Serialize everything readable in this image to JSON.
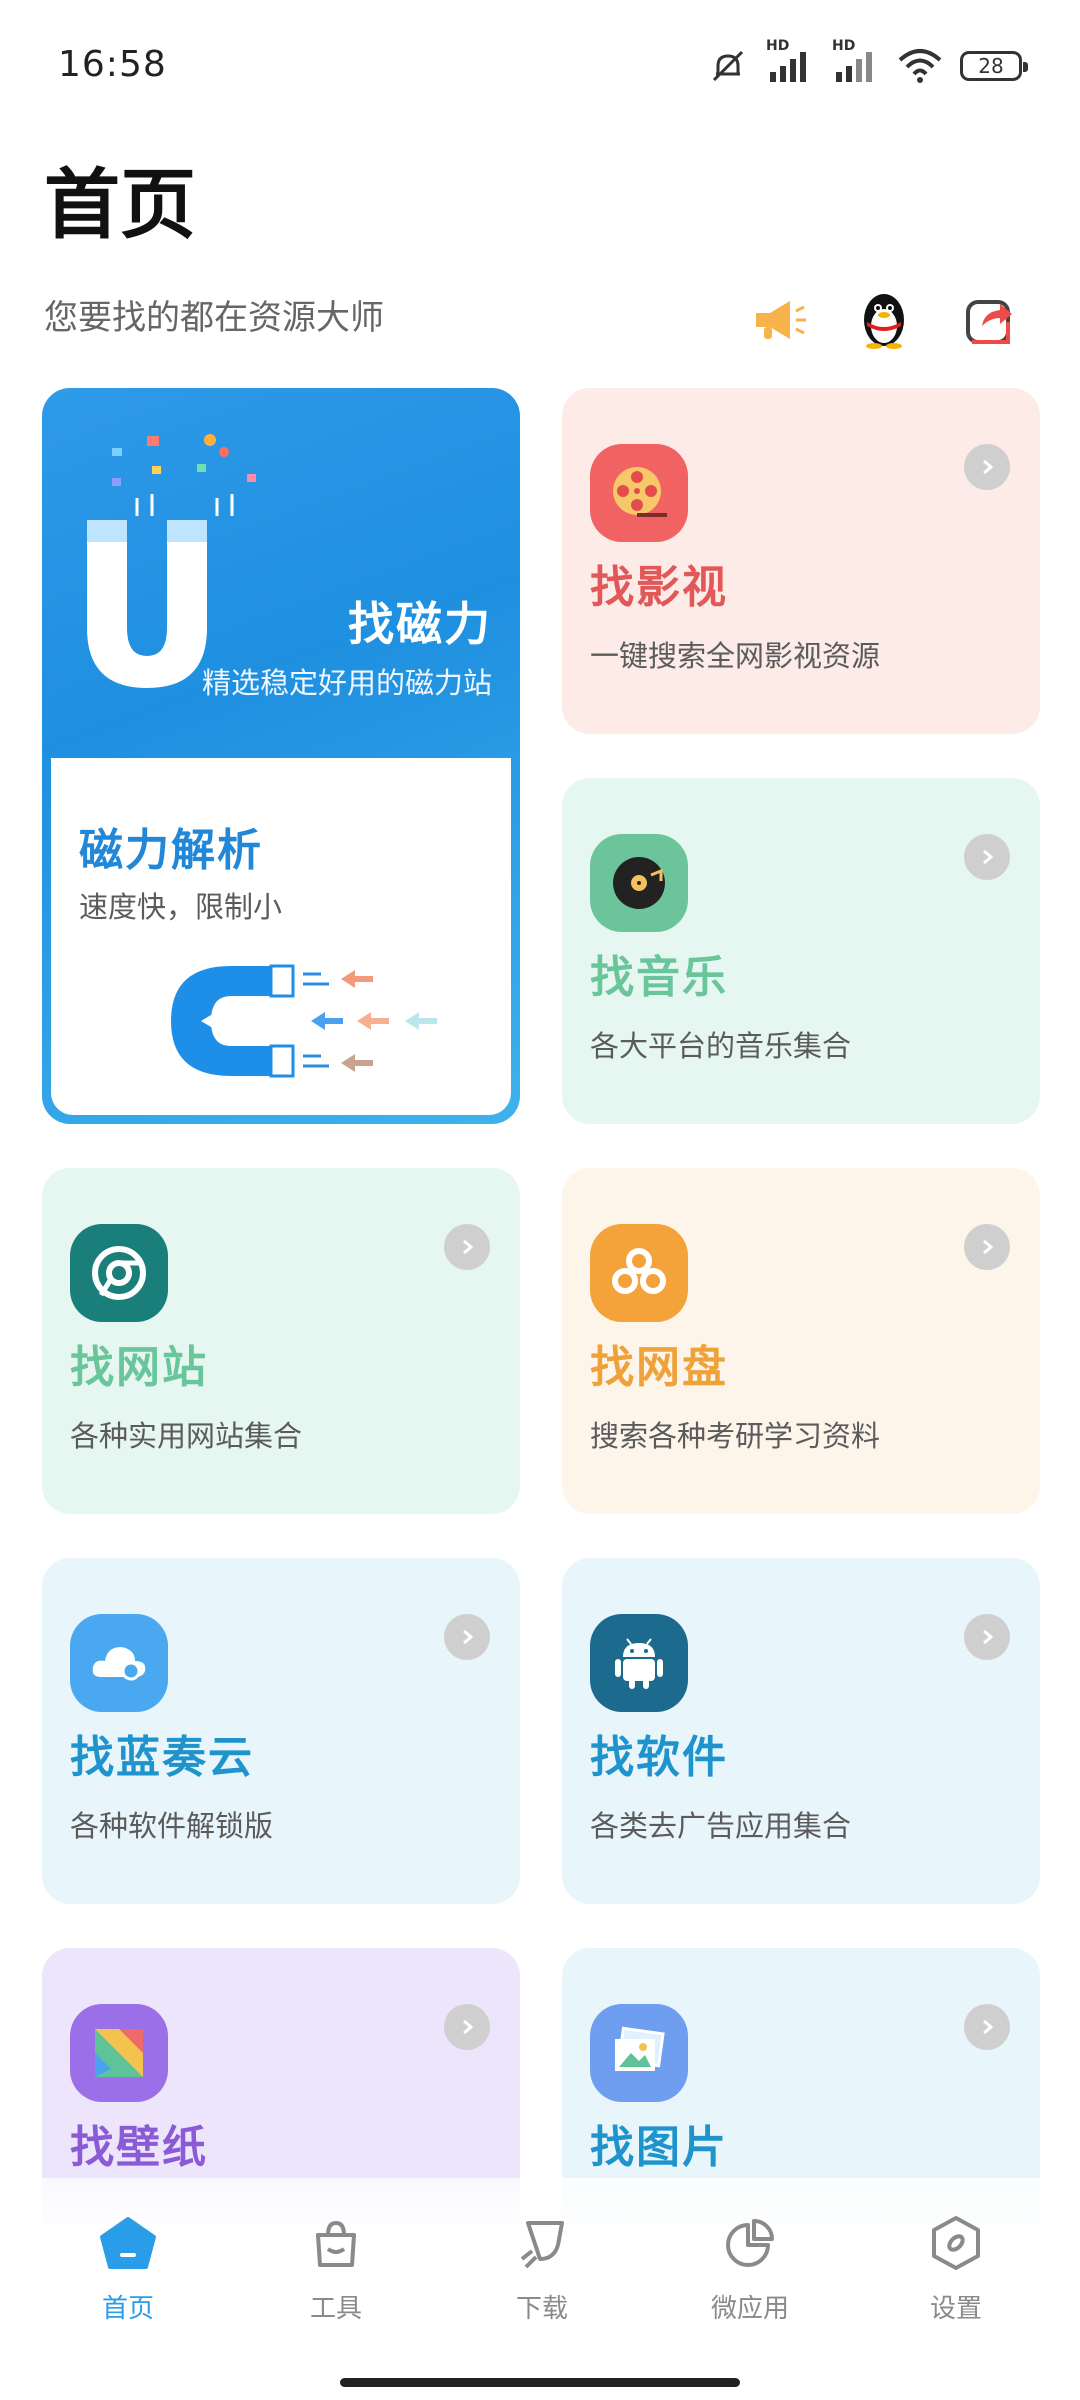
{
  "status_bar": {
    "time": "16:58",
    "battery": "28",
    "signal_label_1": "HD",
    "signal_label_2": "HD"
  },
  "header": {
    "title": "首页",
    "subtitle": "您要找的都在资源大师"
  },
  "header_icons": [
    "megaphone-icon",
    "qq-penguin-icon",
    "share-icon"
  ],
  "magnet_card": {
    "title": "找磁力",
    "desc": "精选稳定好用的磁力站",
    "sub_title": "磁力解析",
    "sub_desc": "速度快，限制小",
    "colors": {
      "bg": "#2196e6",
      "title": "#2187d6"
    }
  },
  "cards": [
    {
      "id": "video",
      "title": "找影视",
      "desc": "一键搜索全网影视资源",
      "icon": "film-reel-icon",
      "bg": "#fcebe7",
      "title_color": "#e25757",
      "icon_bg": "#f16262"
    },
    {
      "id": "music",
      "title": "找音乐",
      "desc": "各大平台的音乐集合",
      "icon": "vinyl-record-icon",
      "bg": "#e6f7f1",
      "title_color": "#69c59a",
      "icon_bg": "#6cc49a"
    },
    {
      "id": "website",
      "title": "找网站",
      "desc": "各种实用网站集合",
      "icon": "chrome-browser-icon",
      "bg": "#e6f7f1",
      "title_color": "#69c59a",
      "icon_bg": "#1a7f7a"
    },
    {
      "id": "netdisk",
      "title": "找网盘",
      "desc": "搜索各种考研学习资料",
      "icon": "cloud-disk-icon",
      "bg": "#fdf5ea",
      "title_color": "#f0a23a",
      "icon_bg": "#f3a33a"
    },
    {
      "id": "lanzou",
      "title": "找蓝奏云",
      "desc": "各种软件解锁版",
      "icon": "cloud-icon",
      "bg": "#e8f6fc",
      "title_color": "#1f94cc",
      "icon_bg": "#4aa8f0"
    },
    {
      "id": "software",
      "title": "找软件",
      "desc": "各类去广告应用集合",
      "icon": "android-icon",
      "bg": "#e8f6fc",
      "title_color": "#1f94cc",
      "icon_bg": "#1d6a8f"
    },
    {
      "id": "wallpaper",
      "title": "找壁纸",
      "desc": "",
      "icon": "wallpaper-icon",
      "bg": "#ece5fb",
      "title_color": "#8b5bd6",
      "icon_bg": "#9b6fe8"
    },
    {
      "id": "images",
      "title": "找图片",
      "desc": "",
      "icon": "photo-icon",
      "bg": "#e8f6fc",
      "title_color": "#1f94cc",
      "icon_bg": "#6f9ef0"
    }
  ],
  "bottom_nav": [
    {
      "label": "首页",
      "icon": "home-icon",
      "active": true
    },
    {
      "label": "工具",
      "icon": "bag-icon",
      "active": false
    },
    {
      "label": "下载",
      "icon": "rocket-icon",
      "active": false
    },
    {
      "label": "微应用",
      "icon": "pie-icon",
      "active": false
    },
    {
      "label": "设置",
      "icon": "settings-icon",
      "active": false
    }
  ]
}
